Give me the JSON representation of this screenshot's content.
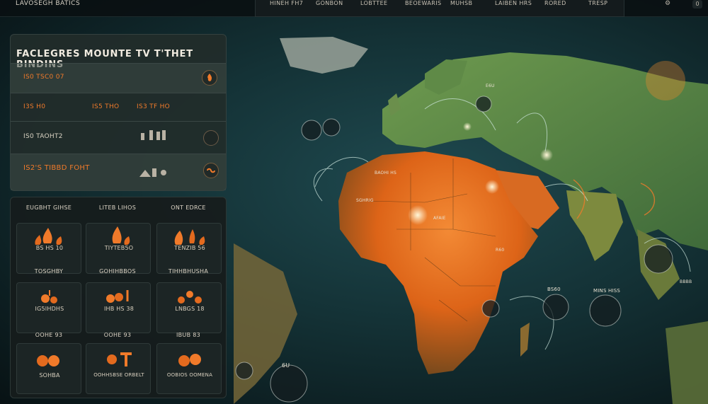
{
  "topbar": {
    "brand": "LAVOSEGH BATICS",
    "nav": [
      "HINEH FH7",
      "GONBON",
      "LOBTTEE",
      "BEOEWARIS",
      "MUHSB",
      "LAIBEN HRS",
      "RORED",
      "TRESP"
    ],
    "badge_count": "0"
  },
  "panel": {
    "title": "FACLEGRES MOUNTE TV T'THET BINDINS",
    "rows": [
      {
        "label": "IS0 TSC0 07"
      },
      {
        "values": [
          "I3S H0",
          "IS5 THO",
          "IS3 TF HO"
        ]
      },
      {
        "label": "IS0 TAOHT2"
      },
      {
        "label": "IS2'S TIBBD FOHT"
      }
    ]
  },
  "grid": {
    "headers": [
      "EUGBHT GIHSE",
      "LITEB LIHOS",
      "ONT EDRCE"
    ],
    "cards": [
      {
        "label": "BS HS 10"
      },
      {
        "label": "TIYTEB5O"
      },
      {
        "label": "TENZIB 56"
      },
      {
        "label": "IG5IHDHS",
        "title": "TOSGHBY"
      },
      {
        "label": "IHB HS 38",
        "title": "GOHIHBBOS"
      },
      {
        "label": "LNBGS 18",
        "title": "TIHHBHUSHA"
      },
      {
        "label": "SOHBA",
        "title": "OOHE 93"
      },
      {
        "label": "OOHHSBSE ORBELT",
        "title": "OOHE 93"
      },
      {
        "label": "OOBIOS OOMENA",
        "title": "IBUB 83"
      }
    ]
  },
  "map": {
    "labels": [
      "BAOHI HS",
      "SGHRIG",
      "AFAIE",
      "BS60",
      "MINS HISS",
      "E6U",
      "6U",
      "BBBB",
      "R60"
    ],
    "colors": {
      "land": "#5b7a45",
      "africa": "#e36a1e",
      "ocean": "#15373b",
      "accent": "#f07a2a"
    }
  }
}
